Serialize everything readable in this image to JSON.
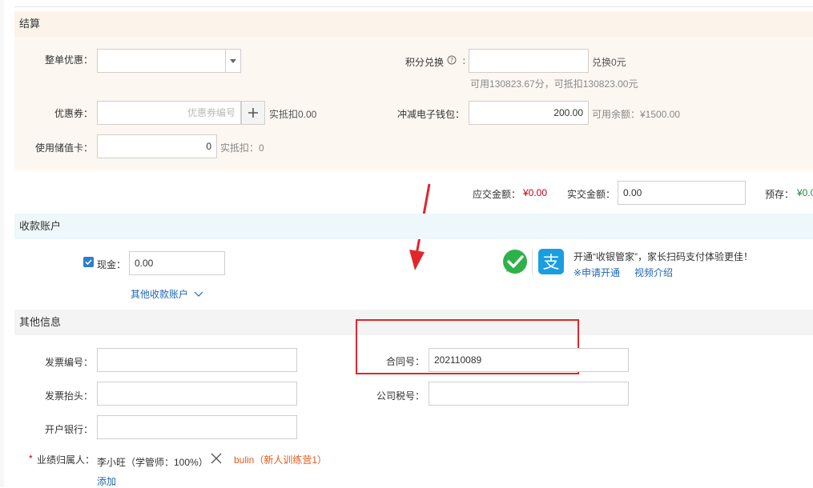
{
  "settlement": {
    "title": "结算",
    "order_discount_label": "整单优惠：",
    "order_discount_value": "",
    "points_label": "积分兑换",
    "points_value": "",
    "points_exchange_text": "兑换0元",
    "points_available_text": "可用130823.67分，可抵扣130823.00元",
    "coupon_label": "优惠券：",
    "coupon_placeholder": "优惠券编号",
    "coupon_deduct_text": "实抵扣0.00",
    "wallet_label": "冲减电子钱包：",
    "wallet_value": "200.00",
    "wallet_balance_text": "可用余额：¥1500.00",
    "stored_card_label": "使用储值卡：",
    "stored_card_value": "0",
    "stored_card_deduct_text": "实抵扣：0"
  },
  "totals": {
    "payable_label": "应交金额：",
    "payable_value": "¥0.00",
    "actual_label": "实交金额：",
    "actual_value": "0.00",
    "prepaid_label": "预存：",
    "prepaid_value": "¥0.0"
  },
  "account": {
    "title": "收款账户",
    "cash_label": "现金：",
    "cash_value": "0.00",
    "other_accounts_link": "其他收款账户",
    "promo_text": "开通“收银管家”，家长扫码支付体验更佳！",
    "apply_link": "※申请开通",
    "video_link": "视频介绍"
  },
  "other_info": {
    "title": "其他信息",
    "invoice_no_label": "发票编号：",
    "invoice_no_value": "",
    "contract_no_label": "合同号：",
    "contract_no_value": "202110089",
    "invoice_title_label": "发票抬头：",
    "invoice_title_value": "",
    "tax_no_label": "公司税号：",
    "tax_no_value": "",
    "bank_label": "开户银行：",
    "bank_value": "",
    "owner_required_mark": "*",
    "owner_label": "业绩归属人：",
    "owner_value": "李小旺（学管师：100%）",
    "owner_extra": "bulin（新人训练营1）",
    "add_link": "添加"
  },
  "colors": {
    "accent_red": "#e0262b",
    "link_blue": "#1f66b6",
    "amount_red": "#c0001a",
    "prepaid_green": "#1a8c3a",
    "wechat_green": "#2fb14a",
    "alipay_blue": "#1a9ee2"
  }
}
